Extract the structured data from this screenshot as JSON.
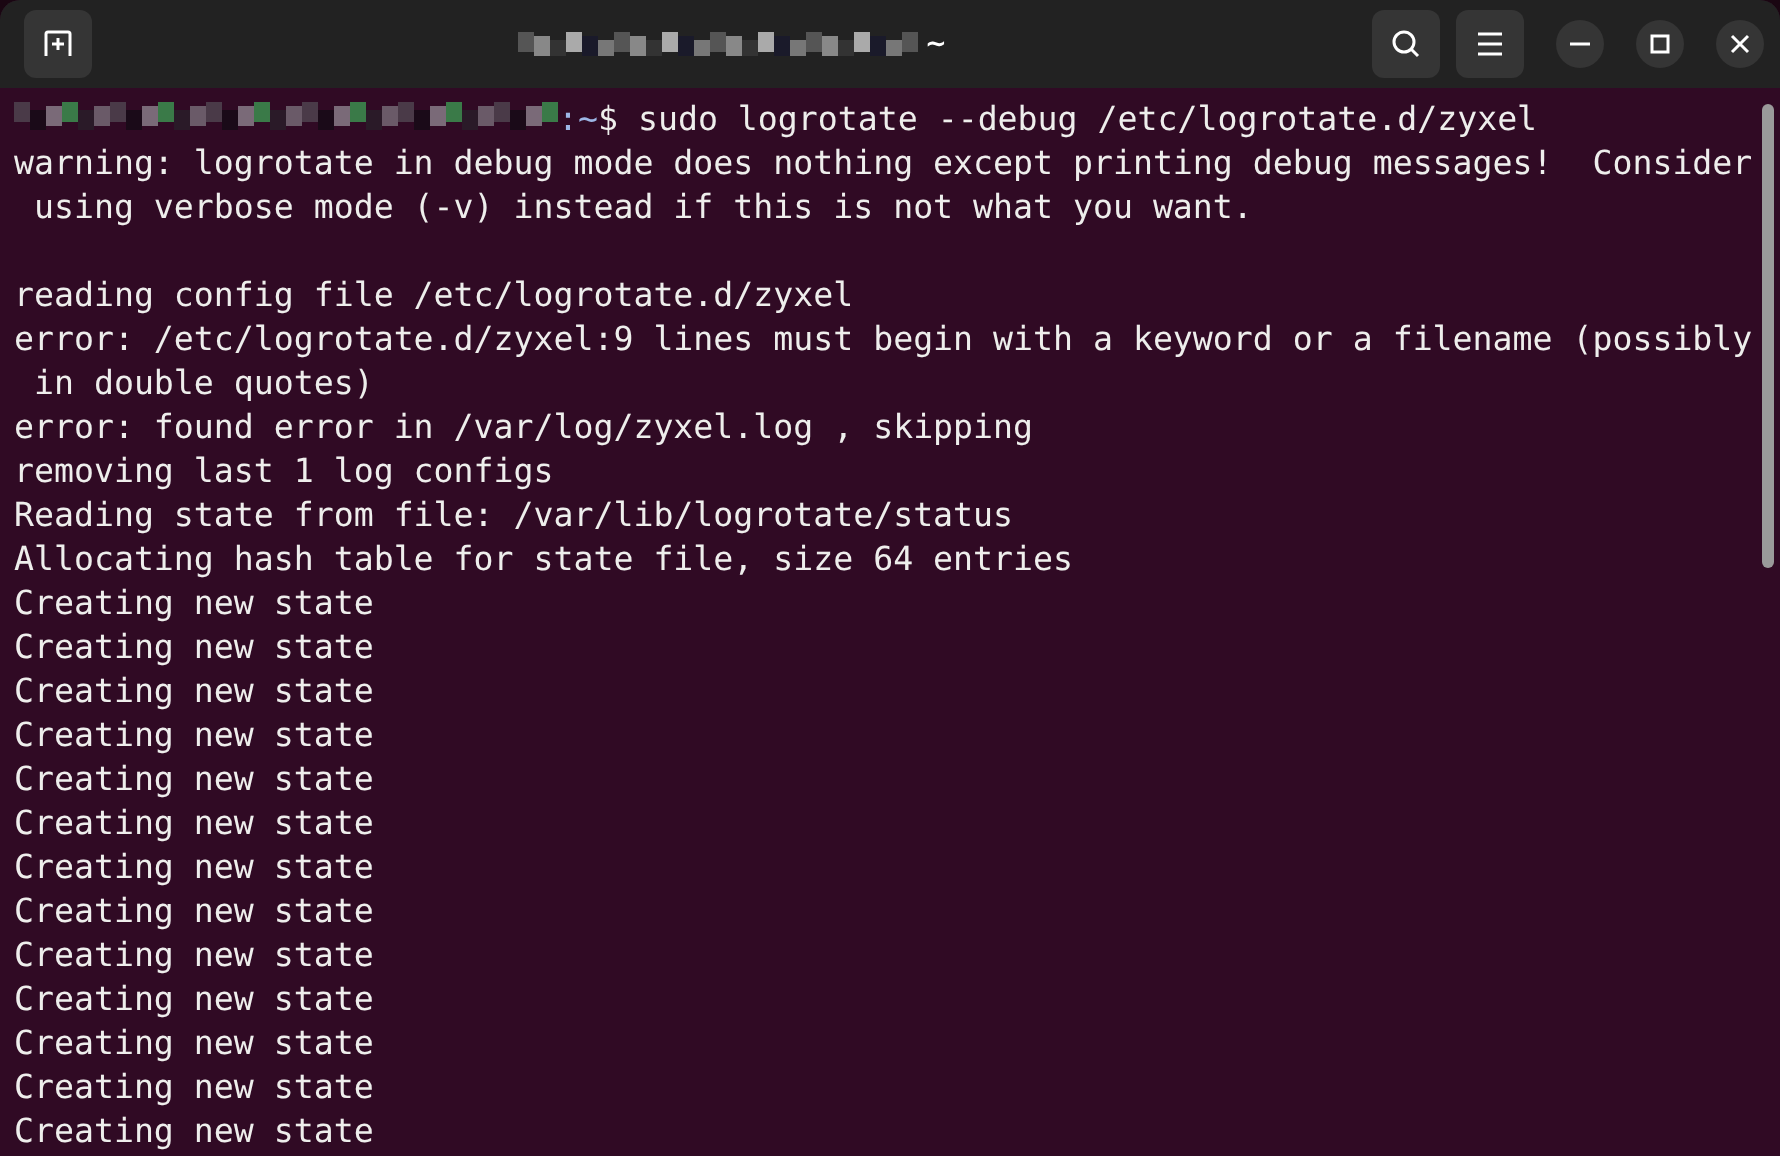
{
  "window": {
    "title": "~"
  },
  "prompt": {
    "path": ":~",
    "symbol": "$",
    "command": "sudo logrotate --debug /etc/logrotate.d/zyxel"
  },
  "lines": [
    {
      "kind": "text",
      "text": "warning: logrotate in debug mode does nothing except printing debug messages!  Consider"
    },
    {
      "kind": "text",
      "text": " using verbose mode (-v) instead if this is not what you want."
    },
    {
      "kind": "blank"
    },
    {
      "kind": "text",
      "text": "reading config file /etc/logrotate.d/zyxel"
    },
    {
      "kind": "text",
      "text": "error: /etc/logrotate.d/zyxel:9 lines must begin with a keyword or a filename (possibly"
    },
    {
      "kind": "text",
      "text": " in double quotes)"
    },
    {
      "kind": "text",
      "text": "error: found error in /var/log/zyxel.log , skipping"
    },
    {
      "kind": "text",
      "text": "removing last 1 log configs"
    },
    {
      "kind": "text",
      "text": "Reading state from file: /var/lib/logrotate/status"
    },
    {
      "kind": "text",
      "text": "Allocating hash table for state file, size 64 entries"
    },
    {
      "kind": "text",
      "text": "Creating new state"
    },
    {
      "kind": "text",
      "text": "Creating new state"
    },
    {
      "kind": "text",
      "text": "Creating new state"
    },
    {
      "kind": "text",
      "text": "Creating new state"
    },
    {
      "kind": "text",
      "text": "Creating new state"
    },
    {
      "kind": "text",
      "text": "Creating new state"
    },
    {
      "kind": "text",
      "text": "Creating new state"
    },
    {
      "kind": "text",
      "text": "Creating new state"
    },
    {
      "kind": "text",
      "text": "Creating new state"
    },
    {
      "kind": "text",
      "text": "Creating new state"
    },
    {
      "kind": "text",
      "text": "Creating new state"
    },
    {
      "kind": "text",
      "text": "Creating new state"
    },
    {
      "kind": "text",
      "text": "Creating new state"
    }
  ]
}
